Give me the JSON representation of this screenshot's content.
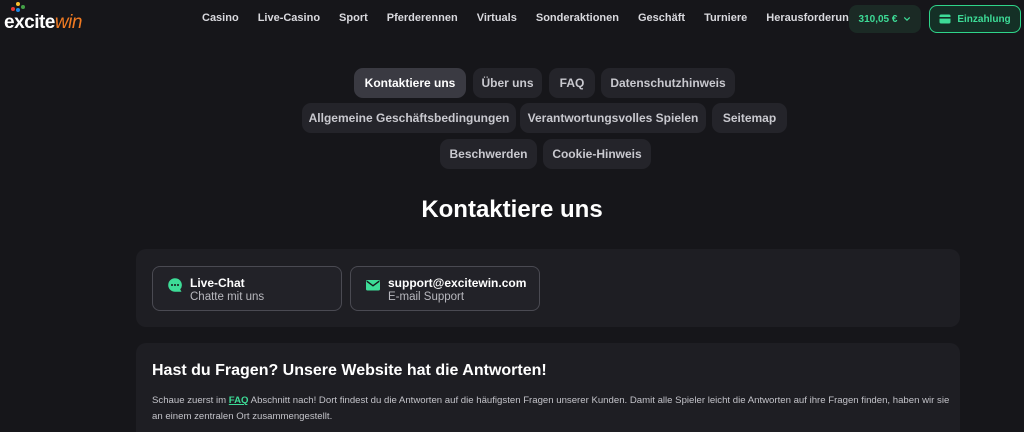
{
  "logo": {
    "part1": "excite",
    "part2": "win",
    "colors": [
      "#e53935",
      "#fbc02d",
      "#43a047",
      "#1e88e5"
    ]
  },
  "nav": {
    "items": [
      "Casino",
      "Live-Casino",
      "Sport",
      "Pferderennen",
      "Virtuals",
      "Sonderaktionen",
      "Geschäft",
      "Turniere",
      "Herausforderungen"
    ]
  },
  "account": {
    "balance": "310,05 €",
    "balance_icon": "chevron-down-icon",
    "deposit_label": "Einzahlung",
    "deposit_icon": "wallet-icon",
    "accent": "#3ddc97"
  },
  "tabs": {
    "items": [
      "Kontaktiere uns",
      "Über uns",
      "FAQ",
      "Datenschutzhinweis",
      "Allgemeine Geschäftsbedingungen",
      "Verantwortungsvolles Spielen",
      "Seitemap",
      "Beschwerden",
      "Cookie-Hinweis"
    ],
    "active": "Kontaktiere uns"
  },
  "page_title": "Kontaktiere uns",
  "contact": {
    "cards": [
      {
        "title": "Live-Chat",
        "subtitle": "Chatte mit uns",
        "icon": "chat-bubble-icon"
      },
      {
        "title": "support@excitewin.com",
        "subtitle": "E-mail Support",
        "icon": "mail-icon"
      }
    ]
  },
  "faq_section": {
    "title": "Hast du Fragen? Unsere Website hat die Antworten!",
    "text_before": "Schaue zuerst im ",
    "link": "FAQ",
    "text_after": " Abschnitt nach! Dort findest du die Antworten auf die häufigsten Fragen unserer Kunden. Damit alle Spieler leicht die Antworten auf ihre Fragen finden, haben wir sie an einem zentralen Ort zusammengestellt."
  }
}
